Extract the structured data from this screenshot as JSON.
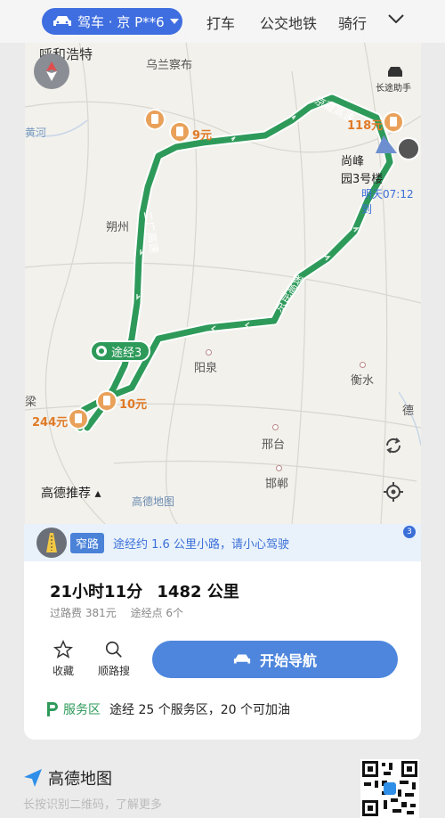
{
  "topbar": {
    "mode_label": "驾车 · 京 P**6",
    "tabs": [
      "打车",
      "公交地铁",
      "骑行"
    ]
  },
  "map": {
    "cities": {
      "hohhot": "呼和浩特",
      "ulanqab": "乌兰察布",
      "shuozhou": "朔州",
      "yangquan": "阳泉",
      "hengshui": "衡水",
      "xingtai": "邢台",
      "handan": "邯郸",
      "dezhou": "德",
      "huanghe": "黄河",
      "li": "梁"
    },
    "road_labels": [
      "京藏高速",
      "二广高速",
      "京昆高速"
    ],
    "tolls": [
      "118元",
      "9元",
      "10元",
      "244元"
    ],
    "via_label": "途经3",
    "changtu_label": "长途助手",
    "destination": [
      "尚峰",
      "园3号楼"
    ],
    "arrive_time": "明天07:12到",
    "recommend_label": "高德推荐",
    "map_brand": "高德地图"
  },
  "panel": {
    "warn_tag": "窄路",
    "warn_text": "途经约 1.6 公里小路，请小心驾驶",
    "warn_count": "3",
    "duration": "21小时11分",
    "distance": "1482 公里",
    "toll_total": "过路费 381元",
    "waypoints": "途经点 6个",
    "collect_label": "收藏",
    "search_label": "顺路搜",
    "start_label": "开始导航",
    "service_label": "服务区",
    "service_text": "途经 25 个服务区，20 个可加油"
  },
  "footer": {
    "brand": "高德地图",
    "hint": "长按识别二维码，了解更多"
  },
  "colors": {
    "accent": "#3f6ee0",
    "route": "#2e9a5a",
    "toll": "#e07a26"
  }
}
